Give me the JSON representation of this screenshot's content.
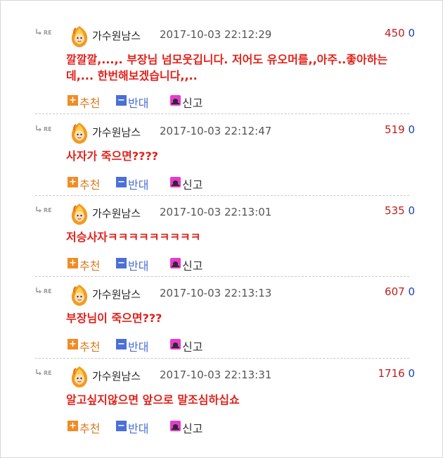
{
  "re_label": "RE",
  "comments": [
    {
      "nickname": "가수원남스",
      "datetime": "2017-10-03 22:12:29",
      "recommend_count": "450",
      "oppose_count": "0",
      "text": "깔깔깔,...,. 부장님 넘모웃깁니다. 저어도 유오머를,,아주..좋아하는데,... 한번해보겠습니다,,.."
    },
    {
      "nickname": "가수원남스",
      "datetime": "2017-10-03 22:12:47",
      "recommend_count": "519",
      "oppose_count": "0",
      "text": "사자가 죽으면????"
    },
    {
      "nickname": "가수원남스",
      "datetime": "2017-10-03 22:13:01",
      "recommend_count": "535",
      "oppose_count": "0",
      "text": "저승사자ㅋㅋㅋㅋㅋㅋㅋㅋㅋ"
    },
    {
      "nickname": "가수원남스",
      "datetime": "2017-10-03 22:13:13",
      "recommend_count": "607",
      "oppose_count": "0",
      "text": "부장님이 죽으면???"
    },
    {
      "nickname": "가수원남스",
      "datetime": "2017-10-03 22:13:31",
      "recommend_count": "1716",
      "oppose_count": "0",
      "text": "알고싶지않으면 앞으로 말조심하십쇼"
    }
  ],
  "actions": {
    "recommend_label": "추천",
    "oppose_label": "반대",
    "report_label": "신고",
    "recommend_symbol": "+",
    "oppose_symbol": "−"
  },
  "colors": {
    "comment_text": "#e1211a",
    "recommend_count": "#c41c1c",
    "oppose_count": "#1a3fbf",
    "recommend_accent": "#f08c23",
    "oppose_accent": "#4a6fd6",
    "report_accent": "#e63bcf"
  },
  "icons": {
    "reply": "reply-arrow-icon",
    "avatar": "flame-avatar-icon",
    "recommend": "plus-icon",
    "oppose": "minus-icon",
    "report": "siren-icon"
  }
}
